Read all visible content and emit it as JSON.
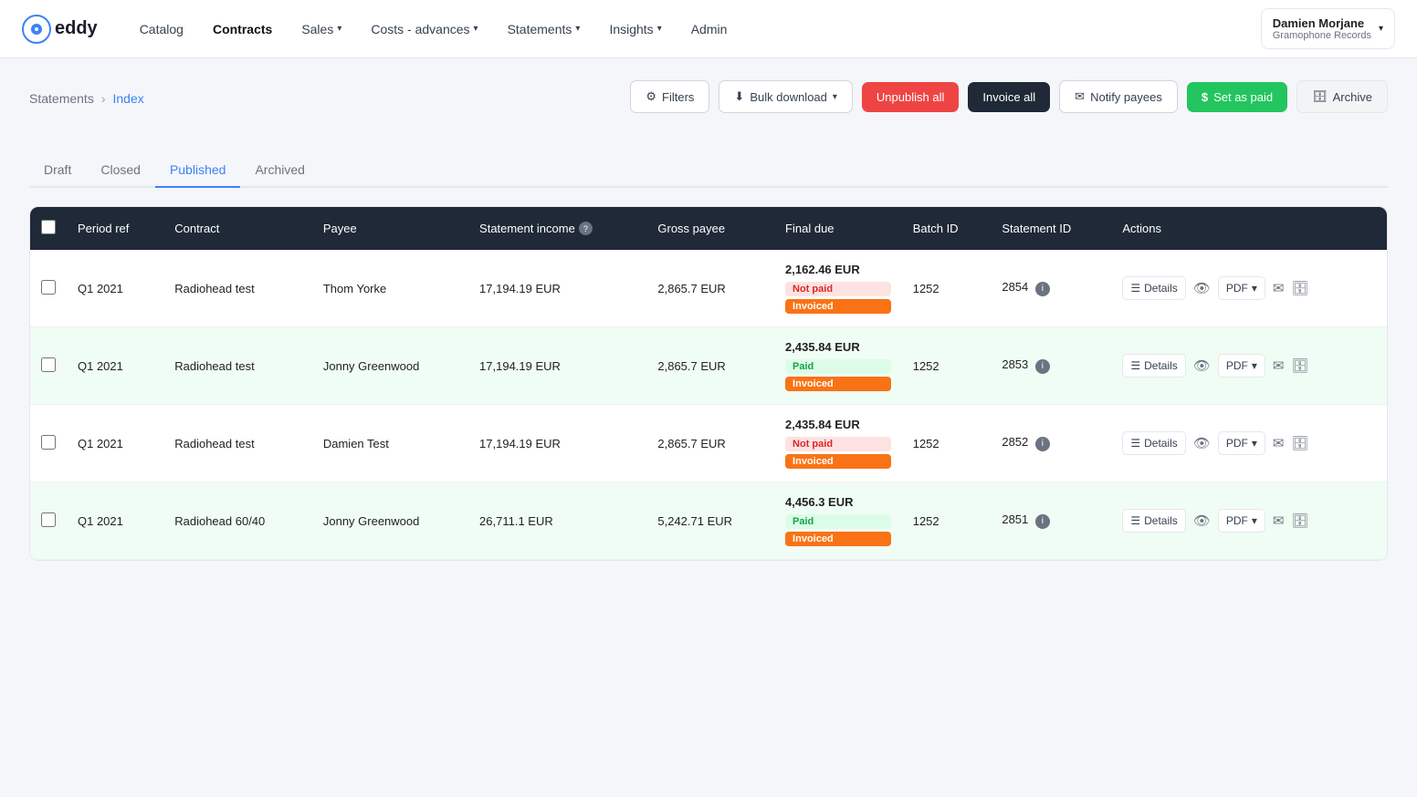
{
  "logo": {
    "symbol": "©eddy",
    "text": "eddy"
  },
  "nav": {
    "items": [
      {
        "id": "catalog",
        "label": "Catalog",
        "has_dropdown": false
      },
      {
        "id": "contracts",
        "label": "Contracts",
        "has_dropdown": false
      },
      {
        "id": "sales",
        "label": "Sales",
        "has_dropdown": true
      },
      {
        "id": "costs-advances",
        "label": "Costs - advances",
        "has_dropdown": true
      },
      {
        "id": "statements",
        "label": "Statements",
        "has_dropdown": true
      },
      {
        "id": "insights",
        "label": "Insights",
        "has_dropdown": true
      },
      {
        "id": "admin",
        "label": "Admin",
        "has_dropdown": false
      }
    ],
    "user": {
      "name": "Damien Morjane",
      "company": "Gramophone Records"
    }
  },
  "breadcrumb": {
    "parent": "Statements",
    "separator": "›",
    "current": "Index"
  },
  "toolbar": {
    "filters_label": "Filters",
    "bulk_download_label": "Bulk download",
    "unpublish_all_label": "Unpublish all",
    "invoice_all_label": "Invoice all",
    "notify_payees_label": "Notify payees",
    "set_as_paid_label": "Set as paid",
    "archive_label": "Archive"
  },
  "tabs": [
    {
      "id": "draft",
      "label": "Draft"
    },
    {
      "id": "closed",
      "label": "Closed"
    },
    {
      "id": "published",
      "label": "Published",
      "active": true
    },
    {
      "id": "archived",
      "label": "Archived"
    }
  ],
  "table": {
    "columns": [
      {
        "id": "checkbox",
        "label": ""
      },
      {
        "id": "period_ref",
        "label": "Period ref"
      },
      {
        "id": "contract",
        "label": "Contract"
      },
      {
        "id": "payee",
        "label": "Payee"
      },
      {
        "id": "statement_income",
        "label": "Statement income",
        "has_info": true
      },
      {
        "id": "gross_payee",
        "label": "Gross payee"
      },
      {
        "id": "final_due",
        "label": "Final due"
      },
      {
        "id": "batch_id",
        "label": "Batch ID"
      },
      {
        "id": "statement_id",
        "label": "Statement ID"
      },
      {
        "id": "actions",
        "label": "Actions"
      }
    ],
    "rows": [
      {
        "id": 1,
        "period_ref": "Q1 2021",
        "contract": "Radiohead test",
        "payee": "Thom Yorke",
        "statement_income": "17,194.19 EUR",
        "gross_payee": "2,865.7 EUR",
        "final_due_amount": "2,162.46 EUR",
        "payment_status": "Not paid",
        "payment_status_type": "red",
        "invoice_status": "Invoiced",
        "invoice_status_type": "orange",
        "batch_id": "1252",
        "statement_id": "2854",
        "has_info": true,
        "row_style": "odd"
      },
      {
        "id": 2,
        "period_ref": "Q1 2021",
        "contract": "Radiohead test",
        "payee": "Jonny Greenwood",
        "statement_income": "17,194.19 EUR",
        "gross_payee": "2,865.7 EUR",
        "final_due_amount": "2,435.84 EUR",
        "payment_status": "Paid",
        "payment_status_type": "green",
        "invoice_status": "Invoiced",
        "invoice_status_type": "orange",
        "batch_id": "1252",
        "statement_id": "2853",
        "has_info": true,
        "row_style": "even"
      },
      {
        "id": 3,
        "period_ref": "Q1 2021",
        "contract": "Radiohead test",
        "payee": "Damien Test",
        "statement_income": "17,194.19 EUR",
        "gross_payee": "2,865.7 EUR",
        "final_due_amount": "2,435.84 EUR",
        "payment_status": "Not paid",
        "payment_status_type": "red",
        "invoice_status": "Invoiced",
        "invoice_status_type": "orange",
        "batch_id": "1252",
        "statement_id": "2852",
        "has_info": true,
        "row_style": "odd"
      },
      {
        "id": 4,
        "period_ref": "Q1 2021",
        "contract": "Radiohead 60/40",
        "payee": "Jonny Greenwood",
        "statement_income": "26,711.1 EUR",
        "gross_payee": "5,242.71 EUR",
        "final_due_amount": "4,456.3 EUR",
        "payment_status": "Paid",
        "payment_status_type": "green",
        "invoice_status": "Invoiced",
        "invoice_status_type": "orange",
        "batch_id": "1252",
        "statement_id": "2851",
        "has_info": true,
        "row_style": "even"
      }
    ],
    "actions": {
      "details_label": "Details",
      "pdf_label": "PDF"
    }
  }
}
